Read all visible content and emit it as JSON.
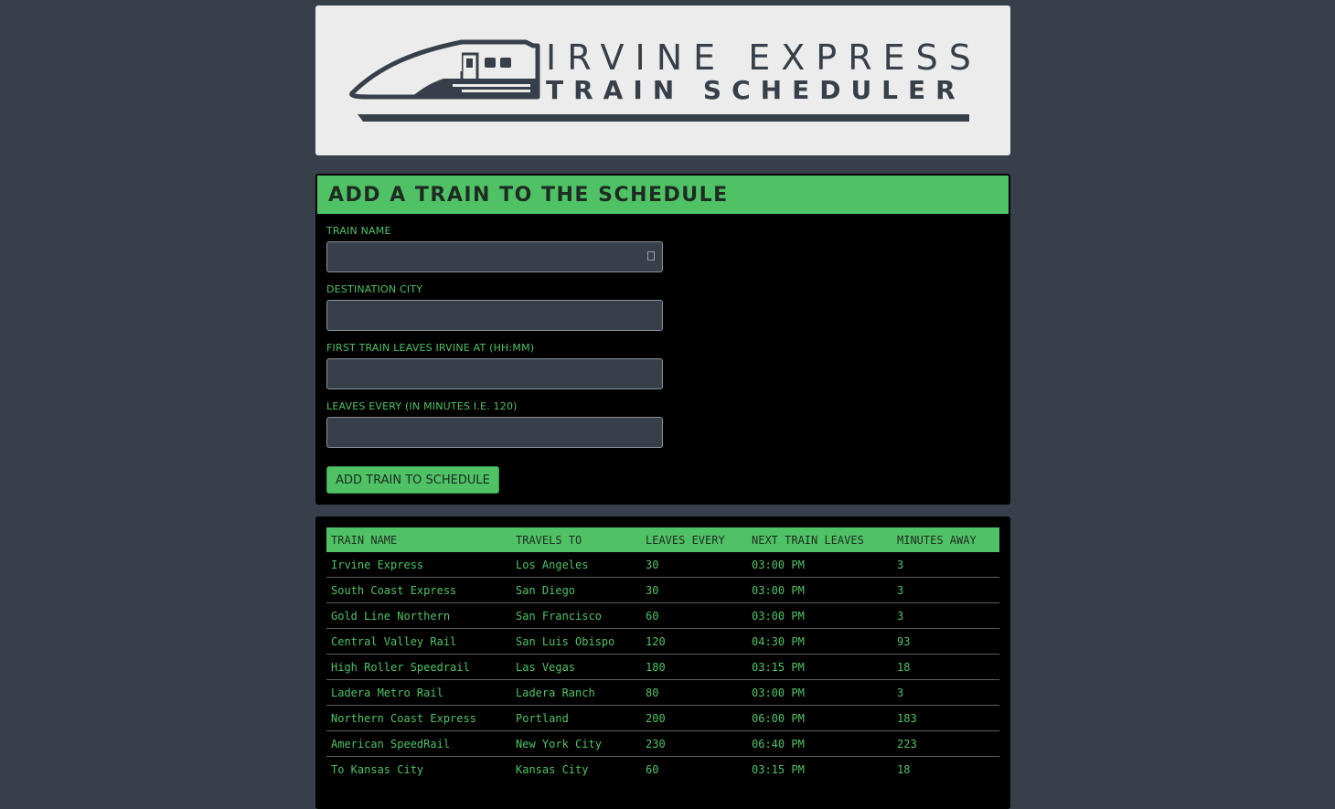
{
  "logo": {
    "line1": "IRVINE EXPRESS",
    "line2": "TRAIN SCHEDULER",
    "icon": "bullet-train-icon"
  },
  "form": {
    "title": "ADD A TRAIN TO THE SCHEDULE",
    "fields": [
      {
        "label": "TRAIN NAME",
        "value": ""
      },
      {
        "label": "DESTINATION CITY",
        "value": ""
      },
      {
        "label": "FIRST TRAIN LEAVES IRVINE AT (HH:MM)",
        "value": ""
      },
      {
        "label": "LEAVES EVERY (IN MINUTES I.E. 120)",
        "value": ""
      }
    ],
    "submit_label": "ADD TRAIN TO SCHEDULE"
  },
  "schedule": {
    "headers": [
      "TRAIN NAME",
      "TRAVELS TO",
      "LEAVES EVERY",
      "NEXT TRAIN LEAVES",
      "MINUTES AWAY"
    ],
    "rows": [
      [
        "Irvine Express",
        "Los Angeles",
        "30",
        "03:00 PM",
        "3"
      ],
      [
        "South Coast Express",
        "San Diego",
        "30",
        "03:00 PM",
        "3"
      ],
      [
        "Gold Line Northern",
        "San Francisco",
        "60",
        "03:00 PM",
        "3"
      ],
      [
        "Central Valley Rail",
        "San Luis Obispo",
        "120",
        "04:30 PM",
        "93"
      ],
      [
        "High Roller Speedrail",
        "Las Vegas",
        "180",
        "03:15 PM",
        "18"
      ],
      [
        "Ladera Metro Rail",
        "Ladera Ranch",
        "80",
        "03:00 PM",
        "3"
      ],
      [
        "Northern Coast Express",
        "Portland",
        "200",
        "06:00 PM",
        "183"
      ],
      [
        "American SpeedRail",
        "New York City",
        "230",
        "06:40 PM",
        "223"
      ],
      [
        "To Kansas City",
        "Kansas City",
        "60",
        "03:15 PM",
        "18"
      ]
    ]
  },
  "colors": {
    "background": "#37404a",
    "accent": "#4fc265",
    "panel": "#000000",
    "logo_bg": "#ececec"
  }
}
